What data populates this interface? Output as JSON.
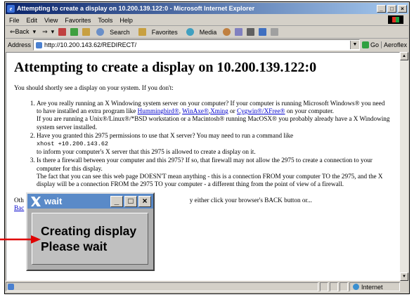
{
  "window": {
    "title": "Attempting to create a display on 10.200.139.122:0 - Microsoft Internet Explorer",
    "controls": [
      "_",
      "□",
      "×"
    ]
  },
  "menu": [
    "File",
    "Edit",
    "View",
    "Favorites",
    "Tools",
    "Help"
  ],
  "toolbar": {
    "back": "⇐Back",
    "forward": "⇒",
    "search": "Search",
    "favorites": "Favorites",
    "media": "Media"
  },
  "address": {
    "label": "Address",
    "value": "http://10.200.143.62/REDIRECT/",
    "go": "Go",
    "links": "Aeroflex"
  },
  "page": {
    "heading": "Attempting to create a display on 10.200.139.122:0",
    "intro": "You should shortly see a display on your system. If you don't:",
    "item1": {
      "p1": "Are you really running an X Windowing system server on your computer? If your computer is running Microsoft Windows® you need to have installed an extra program like ",
      "link1": "Hummingbird®",
      "sep1": ", ",
      "link2": "WinAxe®",
      "sep2": ",",
      "link3": "Xming",
      "or": " or ",
      "link4": "Cygwin®/XFree®",
      "p1_end": " on your computer.",
      "p2": "If you are running a Unix®/Linux®/*BSD workstation or a Macintosh® running MacOSX® you probably already have a X Windowing system server installed."
    },
    "item2": {
      "p1": "Have you granted this 2975 permissions to use that X server? You may need to run a command like",
      "code": "xhost +10.200.143.62",
      "p2": "to inform your computer's X server that this 2975 is allowed to create a display on it."
    },
    "item3": {
      "p1": "Is there a firewall between your computer and this 2975? If so, that firewall may not allow the 2975 to create a connection to your computer for this display.",
      "p2": "The fact that you can see this web page DOESN'T mean anything - this is a connection FROM your computer TO the 2975, and the X display will be a connection FROM the 2975 TO your computer - a different thing from the point of view of a firewall."
    },
    "other_prefix": "Oth",
    "other_suffix": "y either click your browser's BACK button or...",
    "back_link": "Bac"
  },
  "status": {
    "zone": "Internet"
  },
  "wait_window": {
    "title": "wait",
    "line1": "Creating display",
    "line2": "Please wait",
    "controls": [
      "_",
      "□",
      "×"
    ]
  },
  "colors": {
    "titlebar_start": "#0a246a",
    "titlebar_end": "#a6caf0",
    "link": "#0000cc",
    "wait_title": "#5a8ac8",
    "arrow": "#e00000"
  }
}
